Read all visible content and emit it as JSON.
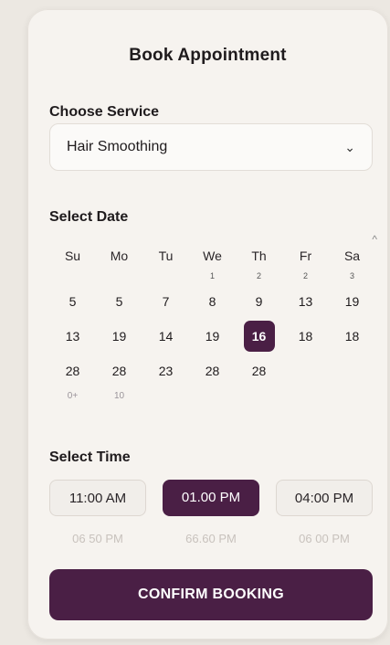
{
  "header": {
    "title": "Book Appointment"
  },
  "service": {
    "label": "Choose Service",
    "value": "Hair Smoothing"
  },
  "date": {
    "label": "Select Date",
    "weekdays": [
      "Su",
      "Mo",
      "Tu",
      "We",
      "Th",
      "Fr",
      "Sa"
    ],
    "tiny_row": [
      "",
      "",
      "",
      "1",
      "2",
      "2",
      "3"
    ],
    "weeks": [
      [
        "5",
        "5",
        "7",
        "8",
        "9",
        "13",
        "19"
      ],
      [
        "13",
        "19",
        "14",
        "19",
        "16",
        "18",
        "18"
      ],
      [
        "28",
        "28",
        "23",
        "28",
        "28",
        "",
        ""
      ]
    ],
    "faint_row": [
      "0+",
      "10",
      "",
      "",
      "",
      "",
      ""
    ],
    "selected": "16"
  },
  "time": {
    "label": "Select Time",
    "slots": [
      "11:00 AM",
      "01.00 PM",
      "04:00 PM"
    ],
    "selected": "01.00 PM",
    "faded": [
      "06 50 PM",
      "66.60 PM",
      "06 00 PM"
    ]
  },
  "actions": {
    "confirm": "CONFIRM BOOKING"
  },
  "colors": {
    "accent": "#4a1f45",
    "card": "#f6f3ef",
    "background": "#ece8e2"
  }
}
